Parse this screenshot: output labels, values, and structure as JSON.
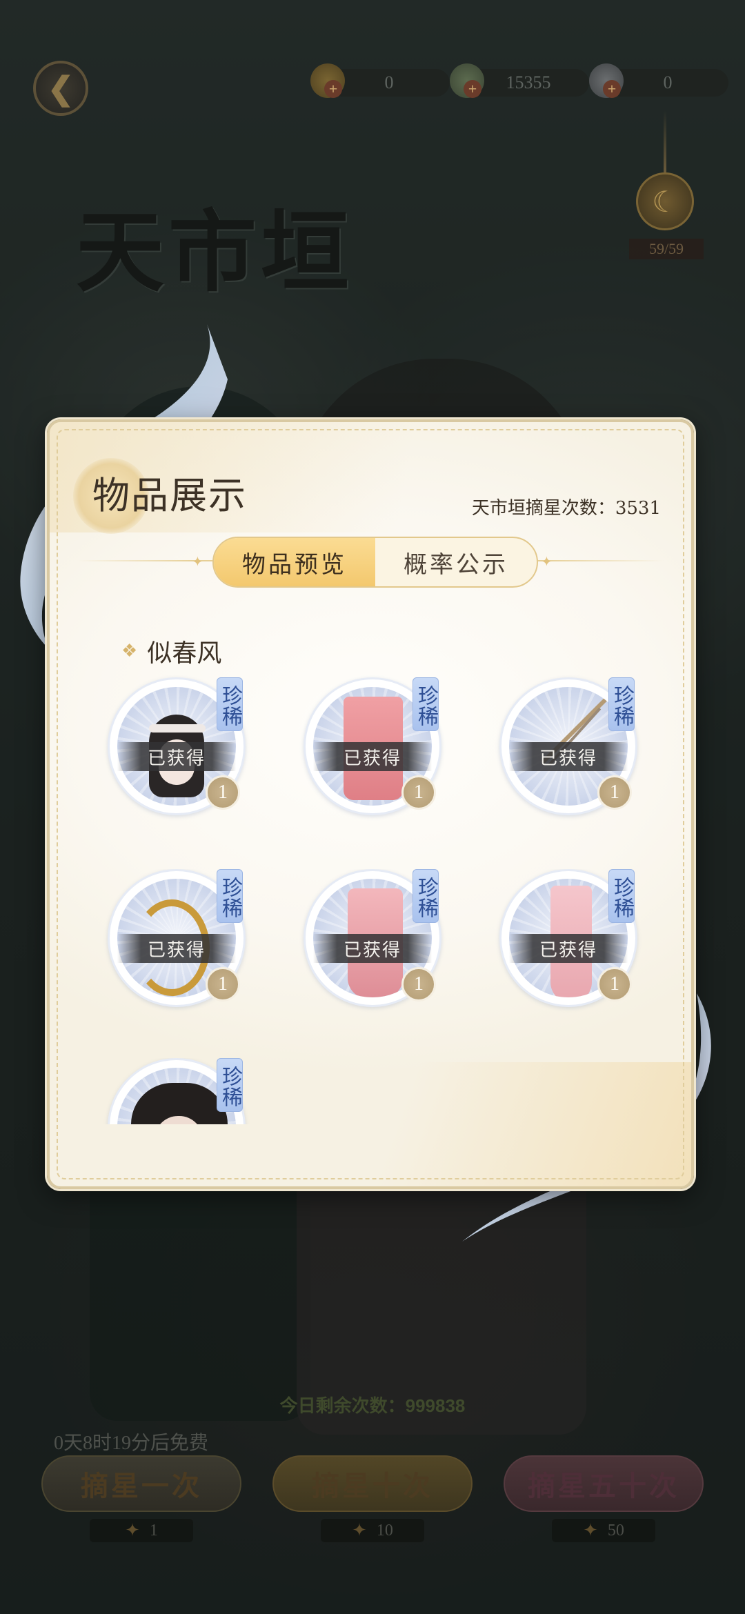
{
  "header": {
    "title": "天市垣",
    "currencies": [
      {
        "icon": "gold-coin-icon",
        "value": "0"
      },
      {
        "icon": "jade-icon",
        "value": "15355"
      },
      {
        "icon": "pearl-icon",
        "value": "0"
      }
    ],
    "moon_count": "59/59"
  },
  "modal": {
    "title": "物品展示",
    "draw_count_label": "天市垣摘星次数：3531",
    "tabs": [
      {
        "label": "物品预览",
        "active": true
      },
      {
        "label": "概率公示",
        "active": false
      }
    ],
    "section_title": "似春风",
    "items": [
      {
        "name": "hair-item",
        "badge": "珍稀",
        "status": "已获得",
        "qty": "1"
      },
      {
        "name": "top-item",
        "badge": "珍稀",
        "status": "已获得",
        "qty": "1"
      },
      {
        "name": "hairpin-item",
        "badge": "珍稀",
        "status": "已获得",
        "qty": "1"
      },
      {
        "name": "bracelet-item",
        "badge": "珍稀",
        "status": "已获得",
        "qty": "1"
      },
      {
        "name": "robe-item",
        "badge": "珍稀",
        "status": "已获得",
        "qty": "1"
      },
      {
        "name": "skirt-item",
        "badge": "珍稀",
        "status": "已获得",
        "qty": "1"
      },
      {
        "name": "portrait-item",
        "badge": "珍稀"
      }
    ]
  },
  "footer": {
    "remaining_today": "今日剩余次数：999838",
    "free_timer": "0天8时19分后免费",
    "buttons": [
      {
        "label": "摘星一次",
        "cost": "1"
      },
      {
        "label": "摘星十次",
        "cost": "10"
      },
      {
        "label": "摘星五十次",
        "cost": "50"
      }
    ]
  },
  "colors": {
    "tab_active": "#f3c86e",
    "rare_badge": "#a9c2ee",
    "modal_bg": "#fbf8f1"
  }
}
